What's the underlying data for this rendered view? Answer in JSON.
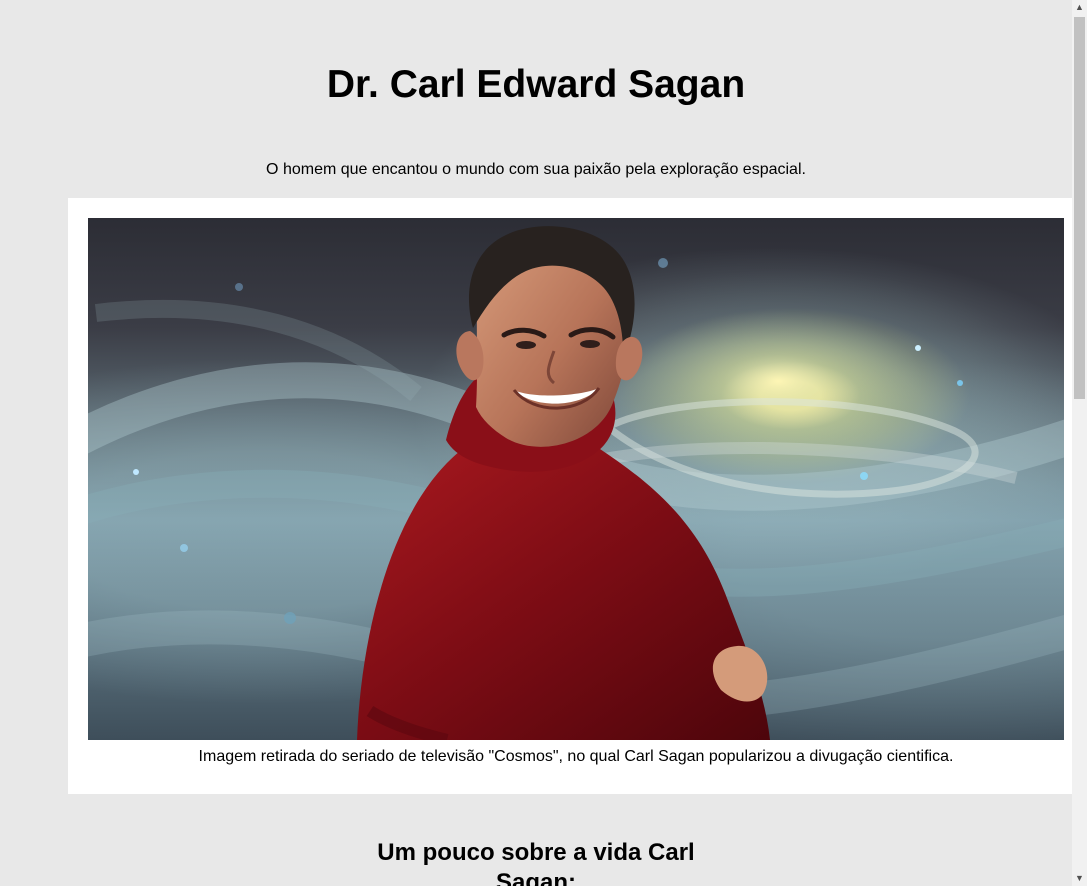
{
  "page": {
    "title": "Dr. Carl Edward Sagan",
    "subtitle": "O homem que encantou o mundo com sua paixão pela exploração espacial.",
    "section_heading": "Um pouco sobre a vida Carl Sagan:"
  },
  "figure": {
    "image_icon": "portrait-photo",
    "caption": "Imagem retirada do seriado de televisão \"Cosmos\", no qual Carl Sagan popularizou a divugação cientifica."
  },
  "scrollbar": {
    "up_icon": "▲",
    "down_icon": "▼"
  },
  "colors": {
    "page_background": "#e8e8e8",
    "figure_background": "#ffffff",
    "scrollbar_track": "#f1f1f1",
    "scrollbar_thumb": "#c1c1c1"
  }
}
